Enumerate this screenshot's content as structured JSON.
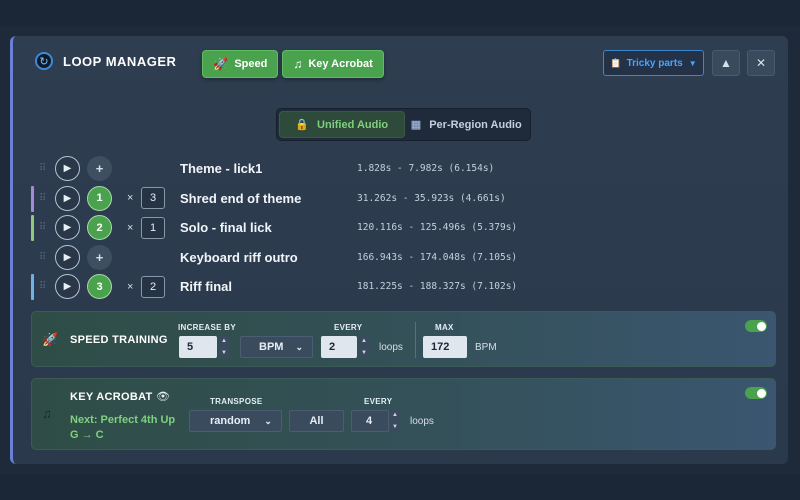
{
  "header": {
    "title": "LOOP MANAGER",
    "buttons": [
      {
        "label": "Speed",
        "icon": "rocket-icon"
      },
      {
        "label": "Key Acrobat",
        "icon": "music-note-icon"
      }
    ],
    "preset_label": "Tricky parts",
    "up_symbol": "▲",
    "close_symbol": "✕"
  },
  "audio_mode": {
    "options": [
      "Unified Audio",
      "Per-Region Audio"
    ],
    "selected": "Unified Audio"
  },
  "loops": [
    {
      "number": "+",
      "name": "Theme - lick1",
      "time": "1.828s - 7.982s (6.154s)",
      "times_sign": "",
      "repeat": "",
      "color": ""
    },
    {
      "number": "1",
      "name": "Shred end of theme",
      "time": "31.262s - 35.923s (4.661s)",
      "times_sign": "×",
      "repeat": "3",
      "color": "#a58ad8"
    },
    {
      "number": "2",
      "name": "Solo - final lick",
      "time": "120.116s - 125.496s (5.379s)",
      "times_sign": "×",
      "repeat": "1",
      "color": "#8fc97a"
    },
    {
      "number": "+",
      "name": "Keyboard riff outro",
      "time": "166.943s - 174.048s (7.105s)",
      "times_sign": "",
      "repeat": "",
      "color": ""
    },
    {
      "number": "3",
      "name": "Riff final",
      "time": "181.225s - 188.327s (7.102s)",
      "times_sign": "×",
      "repeat": "2",
      "color": "#6fb3e6"
    }
  ],
  "speed_training": {
    "title": "SPEED TRAINING",
    "increase_by_label": "INCREASE BY",
    "increase_by_value": "5",
    "unit": "BPM",
    "every_label": "EVERY",
    "every_value": "2",
    "every_unit": "loops",
    "max_label": "MAX",
    "max_value": "172",
    "max_unit": "BPM",
    "enabled": true
  },
  "key_acrobat": {
    "title": "KEY ACROBAT",
    "next_line1": "Next: Perfect 4th Up",
    "next_line2": "G → C",
    "transpose_label": "TRANSPOSE",
    "transpose_value": "random",
    "scope_value": "All",
    "every_label": "EVERY",
    "every_value": "4",
    "every_unit": "loops",
    "enabled": true
  },
  "colors": {
    "accent_green": "#4aa24f",
    "accent_blue": "#4aa3ff",
    "panel_border": "#6c7fd6"
  }
}
